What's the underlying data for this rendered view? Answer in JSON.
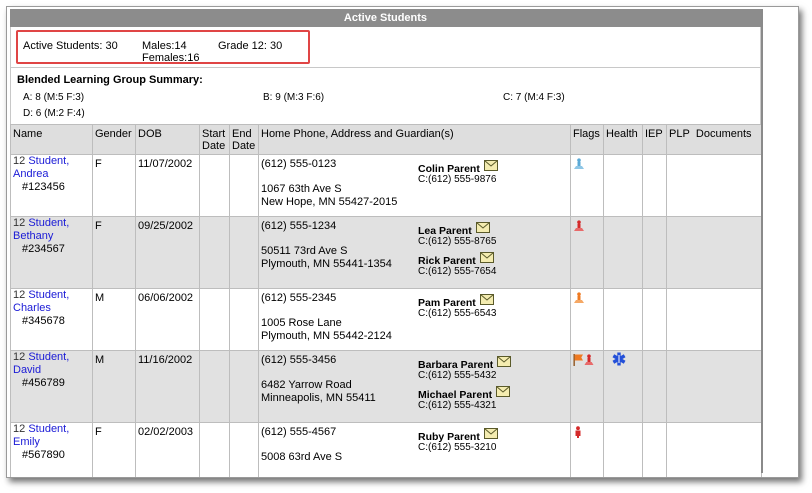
{
  "header": {
    "title": "Active Students"
  },
  "counts": {
    "active": "Active Students: 30",
    "males": "Males:14",
    "females": "Females:16",
    "grade12": "Grade 12: 30"
  },
  "summary": {
    "title": "Blended Learning Group Summary:",
    "groups": [
      "A: 8 (M:5   F:3)",
      "B: 9 (M:3   F:6)",
      "C: 7 (M:4   F:3)",
      "D: 6 (M:2   F:4)"
    ]
  },
  "columns": {
    "name": "Name",
    "gender": "Gender",
    "dob": "DOB",
    "start": "Start Date",
    "end": "End Date",
    "address": "Home Phone, Address and Guardian(s)",
    "flags": "Flags",
    "health": "Health",
    "iep": "IEP",
    "plp": "PLP",
    "documents": "Documents"
  },
  "students": [
    {
      "grade": "12",
      "last": "Student,",
      "first": "Andrea",
      "number": "#123456",
      "gender": "F",
      "dob": "11/07/2002",
      "phone": "(612) 555-0123",
      "street": "1067 63th Ave S",
      "city": "New Hope, MN 55427-2015",
      "guardians": [
        {
          "name": "Colin Parent",
          "phone": "C:(612) 555-9876"
        }
      ]
    },
    {
      "grade": "12",
      "last": "Student,",
      "first": "Bethany",
      "number": "#234567",
      "gender": "F",
      "dob": "09/25/2002",
      "phone": "(612) 555-1234",
      "street": "50511 73rd Ave S",
      "city": "Plymouth, MN 55441-1354",
      "guardians": [
        {
          "name": "Lea Parent",
          "phone": "C:(612) 555-8765"
        },
        {
          "name": "Rick Parent",
          "phone": "C:(612) 555-7654"
        }
      ]
    },
    {
      "grade": "12",
      "last": "Student,",
      "first": "Charles",
      "number": "#345678",
      "gender": "M",
      "dob": "06/06/2002",
      "phone": "(612) 555-2345",
      "street": "1005 Rose Lane",
      "city": "Plymouth, MN 55442-2124",
      "guardians": [
        {
          "name": "Pam Parent",
          "phone": "C:(612) 555-6543"
        }
      ]
    },
    {
      "grade": "12",
      "last": "Student,",
      "first": "David",
      "number": "#456789",
      "gender": "M",
      "dob": "11/16/2002",
      "phone": "(612) 555-3456",
      "street": "6482 Yarrow Road",
      "city": "Minneapolis, MN 55411",
      "guardians": [
        {
          "name": "Barbara Parent",
          "phone": "C:(612) 555-5432"
        },
        {
          "name": "Michael Parent",
          "phone": "C:(612) 555-4321"
        }
      ]
    },
    {
      "grade": "12",
      "last": "Student,",
      "first": "Emily",
      "number": "#567890",
      "gender": "F",
      "dob": "02/02/2003",
      "phone": "(612) 555-4567",
      "street": "5008 63rd Ave S",
      "city": "",
      "guardians": [
        {
          "name": "Ruby Parent",
          "phone": "C:(612) 555-3210"
        }
      ]
    }
  ],
  "colors": {
    "title_bar": "#8c8c8c",
    "highlight": "#e04545",
    "link": "#1a1ad6",
    "flag_blue": "#5aa9d6",
    "flag_red": "#d42a2a",
    "flag_orange": "#ef7a22",
    "health_blue": "#2450d8"
  }
}
